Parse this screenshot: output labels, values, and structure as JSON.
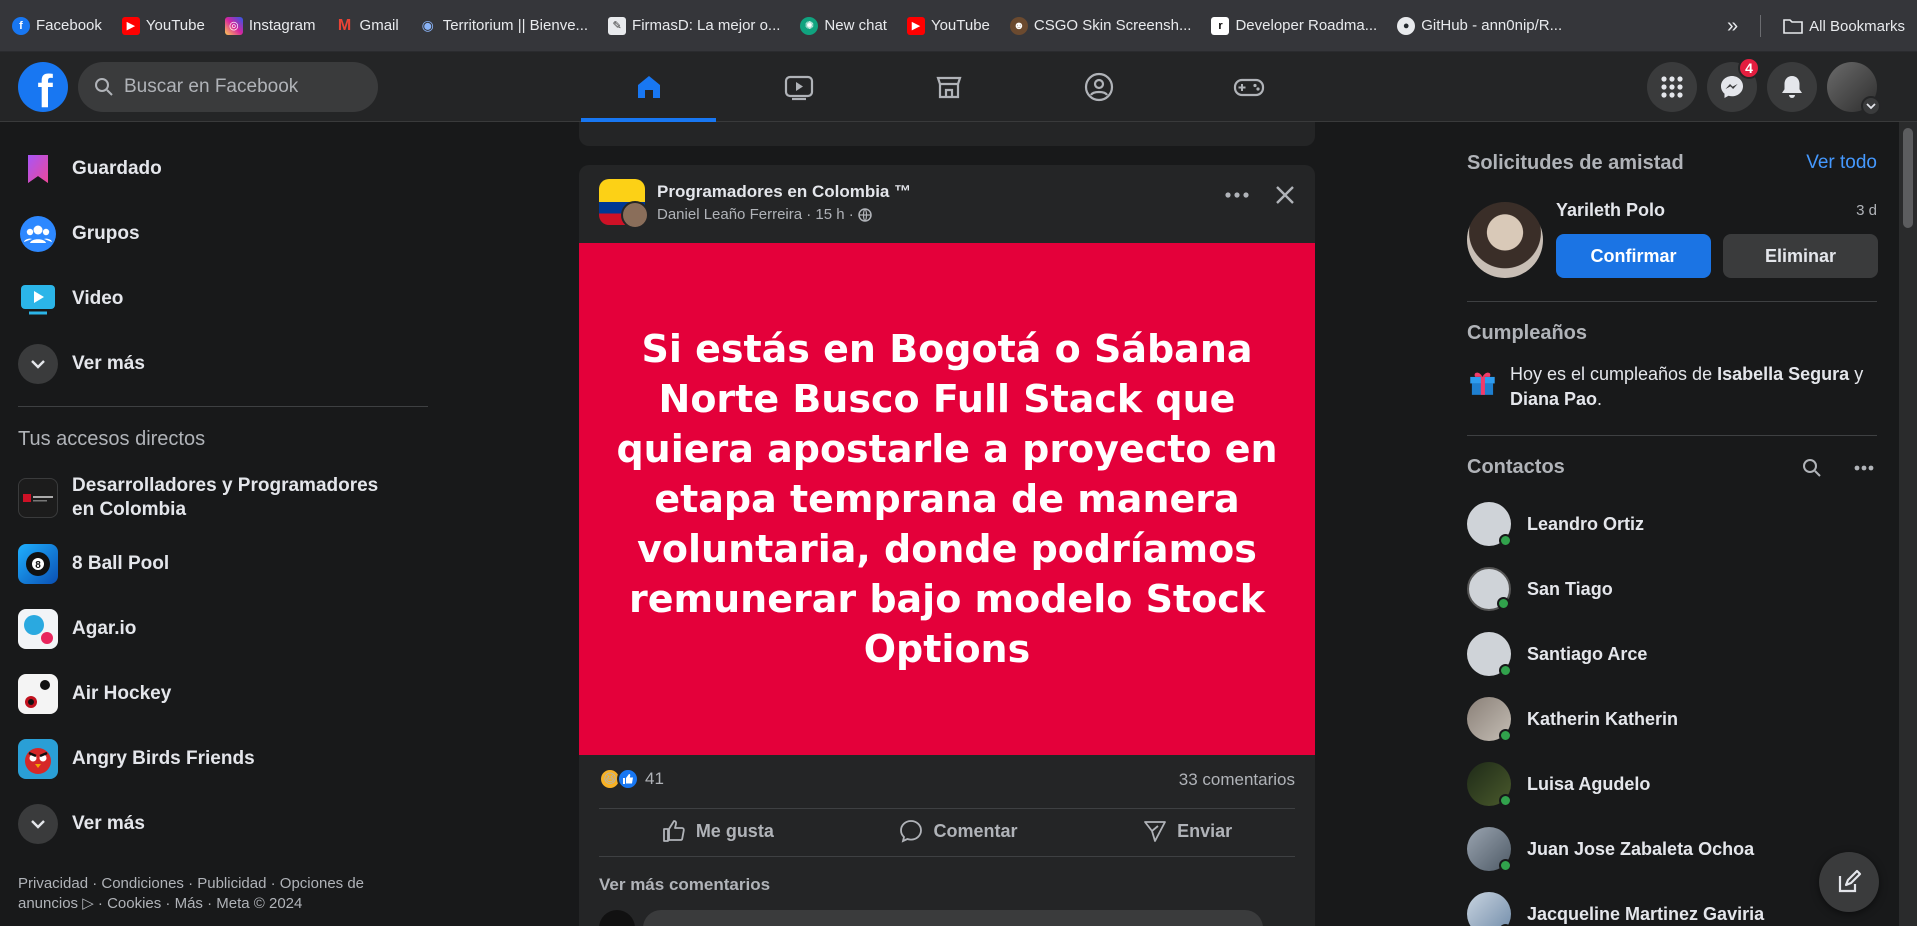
{
  "bookmarks": [
    {
      "label": "Facebook",
      "icon": "facebook-icon",
      "color": "#1877f2"
    },
    {
      "label": "YouTube",
      "icon": "youtube-icon",
      "color": "#ff0000"
    },
    {
      "label": "Instagram",
      "icon": "instagram-icon",
      "color": "#d6249f"
    },
    {
      "label": "Gmail",
      "icon": "gmail-icon",
      "color": "#ea4335"
    },
    {
      "label": "Territorium || Bienve...",
      "icon": "territorium-icon",
      "color": "#4a7bd1"
    },
    {
      "label": "FirmasD: La mejor o...",
      "icon": "firmasd-icon",
      "color": "#444"
    },
    {
      "label": "New chat",
      "icon": "chatgpt-icon",
      "color": "#10a37f"
    },
    {
      "label": "YouTube",
      "icon": "youtube-icon",
      "color": "#ff0000"
    },
    {
      "label": "CSGO Skin Screensh...",
      "icon": "csgo-icon",
      "color": "#6b4a2f"
    },
    {
      "label": "Developer Roadma...",
      "icon": "roadmap-icon",
      "color": "#000"
    },
    {
      "label": "GitHub - ann0nip/R...",
      "icon": "github-icon",
      "color": "#fff"
    }
  ],
  "all_bookmarks": "All Bookmarks",
  "search": {
    "placeholder": "Buscar en Facebook"
  },
  "nav": {
    "messenger_badge": "4"
  },
  "left": {
    "items": [
      {
        "label": "Guardado",
        "icon": "bookmark-icon"
      },
      {
        "label": "Grupos",
        "icon": "groups-icon"
      },
      {
        "label": "Video",
        "icon": "video-icon"
      },
      {
        "label": "Ver más",
        "icon": "chevron-down-icon"
      }
    ],
    "shortcuts_title": "Tus accesos directos",
    "shortcuts": [
      {
        "label": "Desarrolladores y Programadores en Colombia"
      },
      {
        "label": "8 Ball Pool"
      },
      {
        "label": "Agar.io"
      },
      {
        "label": "Air Hockey"
      },
      {
        "label": "Angry Birds Friends"
      },
      {
        "label": "Ver más"
      }
    ],
    "footer": "Privacidad · Condiciones · Publicidad · Opciones de anuncios ▷ · Cookies · Más · Meta © 2024"
  },
  "post": {
    "group": "Programadores en Colombia ™",
    "author_meta": "Daniel Leaño Ferreira · 15 h ·",
    "banner_text": "Si estás en Bogotá o Sábana Norte Busco Full Stack que quiera apostarle a proyecto en etapa temprana de manera voluntaria, donde podríamos remunerar bajo modelo Stock Options",
    "banner_color": "#e4003a",
    "reaction_count": "41",
    "comments_count": "33 comentarios",
    "like_label": "Me gusta",
    "comment_label": "Comentar",
    "send_label": "Enviar",
    "more_comments": "Ver más comentarios"
  },
  "right": {
    "requests_title": "Solicitudes de amistad",
    "see_all": "Ver todo",
    "request": {
      "name": "Yarileth Polo",
      "time": "3 d",
      "confirm": "Confirmar",
      "delete": "Eliminar"
    },
    "birthdays_title": "Cumpleaños",
    "birthday_prefix": "Hoy es el cumpleaños de",
    "birthday_name1": "Isabella Segura",
    "birthday_and": "y",
    "birthday_name2": "Diana Pao",
    "birthday_suffix": ".",
    "contacts_title": "Contactos",
    "contacts": [
      {
        "name": "Leandro Ortiz"
      },
      {
        "name": "San Tiago"
      },
      {
        "name": "Santiago Arce"
      },
      {
        "name": "Katherin Katherin"
      },
      {
        "name": "Luisa Agudelo"
      },
      {
        "name": "Juan Jose Zabaleta Ochoa"
      },
      {
        "name": "Jacqueline Martinez Gaviria"
      }
    ]
  },
  "colors": {
    "accent": "#1877f2",
    "online": "#31a24c",
    "link": "#4599ff"
  }
}
